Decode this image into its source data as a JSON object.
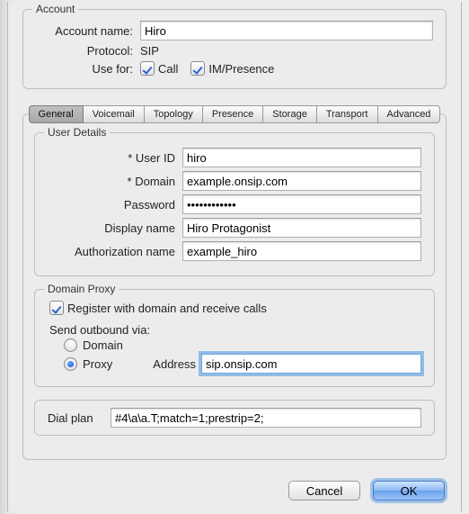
{
  "account": {
    "legend": "Account",
    "name_label": "Account name:",
    "name_value": "Hiro",
    "protocol_label": "Protocol:",
    "protocol_value": "SIP",
    "usefor_label": "Use for:",
    "call_label": "Call",
    "im_label": "IM/Presence"
  },
  "tabs": [
    "General",
    "Voicemail",
    "Topology",
    "Presence",
    "Storage",
    "Transport",
    "Advanced"
  ],
  "user_details": {
    "legend": "User Details",
    "user_id_label": "* User ID",
    "user_id_value": "hiro",
    "domain_label": "* Domain",
    "domain_value": "example.onsip.com",
    "password_label": "Password",
    "password_value": "••••••••••••",
    "display_label": "Display name",
    "display_value": "Hiro Protagonist",
    "auth_label": "Authorization name",
    "auth_value": "example_hiro"
  },
  "domain_proxy": {
    "legend": "Domain Proxy",
    "register_label": "Register with domain and receive calls",
    "send_label": "Send outbound via:",
    "opt_domain": "Domain",
    "opt_proxy": "Proxy",
    "address_label": "Address",
    "address_value": "sip.onsip.com"
  },
  "dial_plan": {
    "label": "Dial plan",
    "value": "#4\\a\\a.T;match=1;prestrip=2;"
  },
  "buttons": {
    "cancel": "Cancel",
    "ok": "OK"
  }
}
